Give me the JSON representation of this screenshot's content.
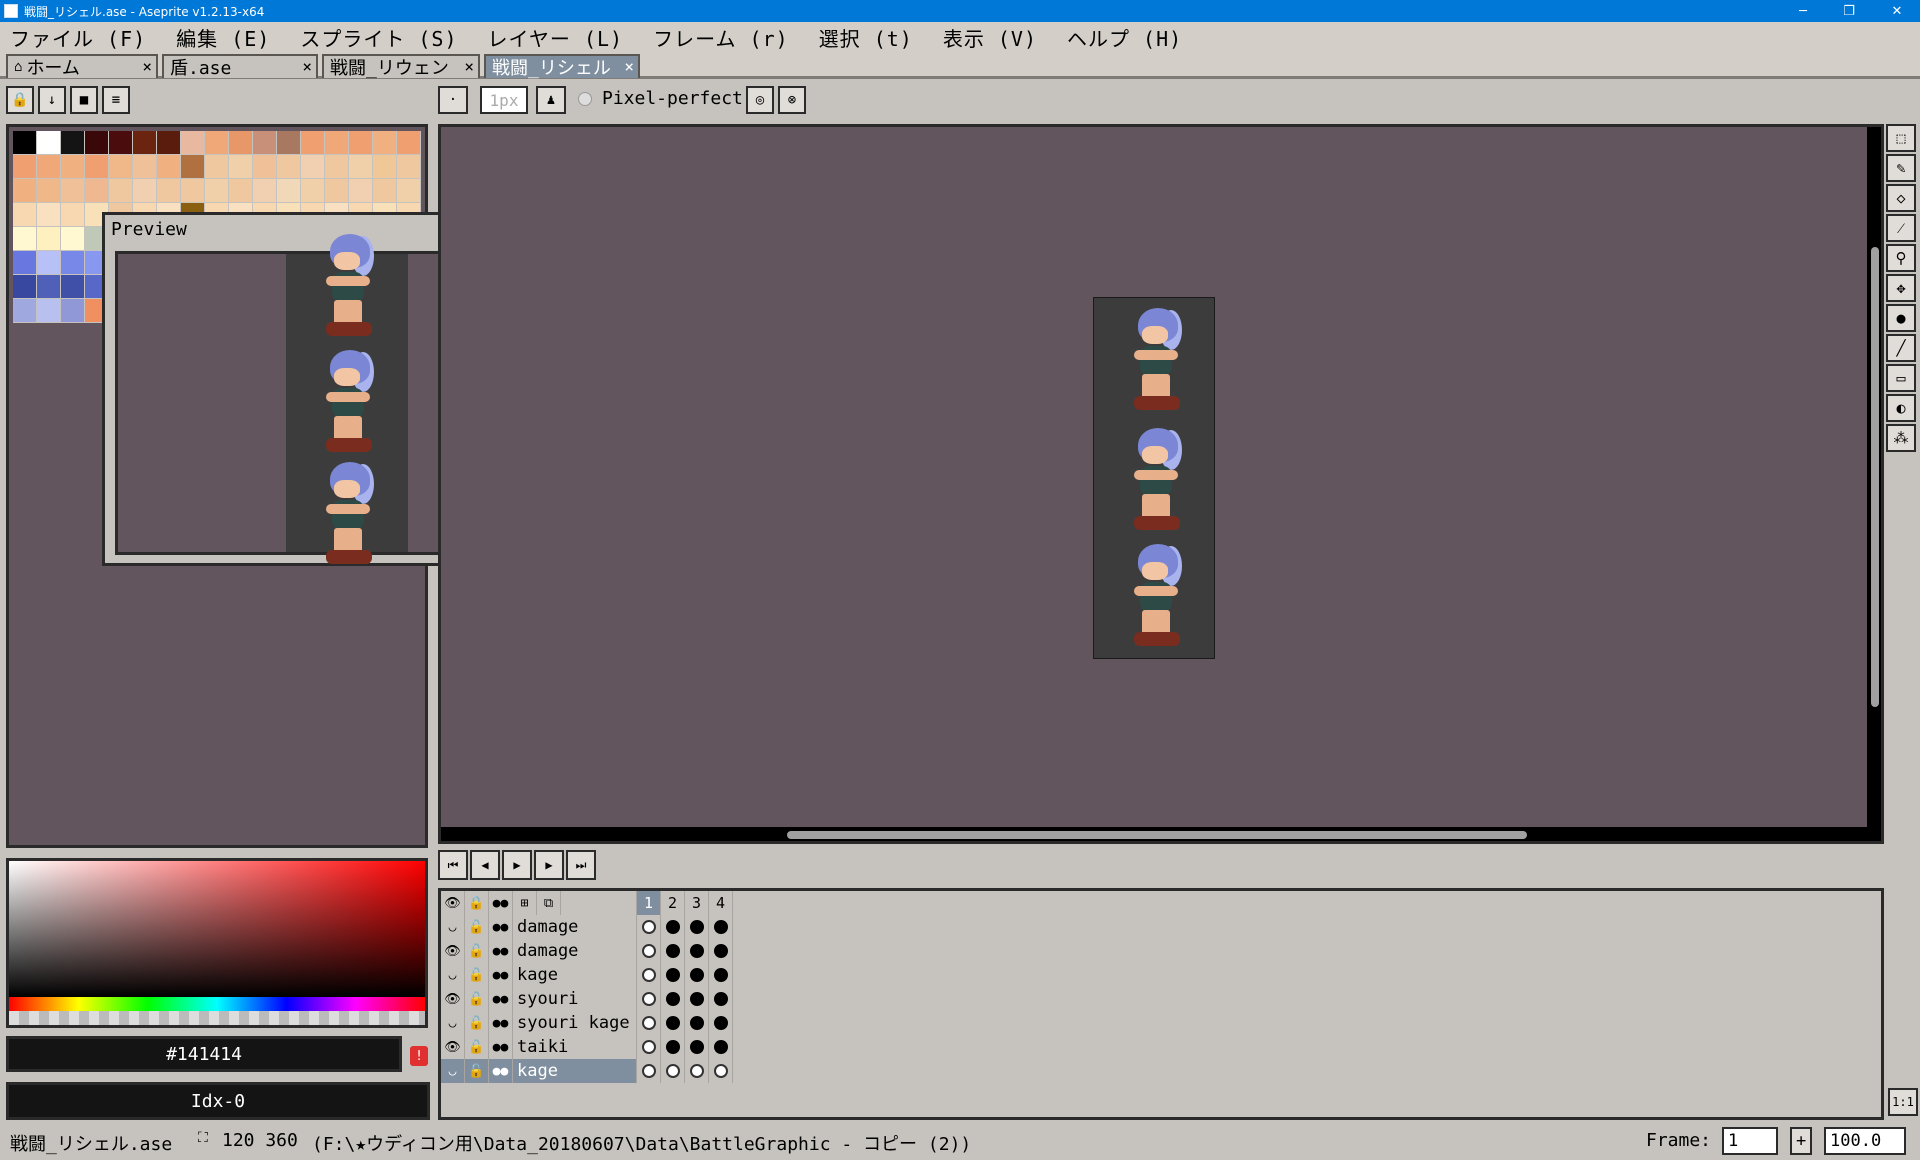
{
  "window": {
    "title": "戦闘_リシェル.ase - Aseprite v1.2.13-x64",
    "minimize": "─",
    "restore": "❐",
    "close": "✕"
  },
  "menu": [
    "ファイル (F)",
    "編集 (E)",
    "スプライト (S)",
    "レイヤー (L)",
    "フレーム (r)",
    "選択 (t)",
    "表示 (V)",
    "ヘルプ (H)"
  ],
  "tabs": [
    {
      "label": "ホーム",
      "close": "×"
    },
    {
      "label": "盾.ase",
      "close": "×"
    },
    {
      "label": "戦闘_リウェン",
      "close": "×"
    },
    {
      "label": "戦闘_リシェル",
      "close": "×"
    }
  ],
  "context_bar": {
    "brush_size": "1px",
    "pixel_perfect_label": "Pixel-perfect"
  },
  "palette": [
    "#000000",
    "#ffffff",
    "#141414",
    "#3a0808",
    "#4a0c0c",
    "#6a2410",
    "#5a1c0c",
    "#e8b8a0",
    "#f0a878",
    "#e89868",
    "#c89078",
    "#a87860",
    "#f0a070",
    "#f0a878",
    "#f0a070",
    "#f0b080",
    "#f0a070",
    "#f0a070",
    "#f0a878",
    "#f0b080",
    "#f0a070",
    "#f0b888",
    "#f0c098",
    "#f0b080",
    "#b07040",
    "#f0c8a0",
    "#f0d0a8",
    "#f0c098",
    "#f0c8a0",
    "#f0d0b0",
    "#f0c8a0",
    "#f0d0a8",
    "#f0c898",
    "#f0c8a0",
    "#f0b080",
    "#f0b888",
    "#f0c098",
    "#f0b890",
    "#f0c8a0",
    "#f0d0b0",
    "#f0c8a0",
    "#f0c8a0",
    "#f0d0a8",
    "#f0c8a0",
    "#f0d0b0",
    "#f0d8b8",
    "#f0d0a8",
    "#f0c8a0",
    "#f0d0b0",
    "#f0c8a0",
    "#f0d0a8",
    "#f8d8b0",
    "#f8e0c0",
    "#f8d8b0",
    "#f8e0b8",
    "#f0c8a0",
    "#f8d8b0",
    "#f8e0c0",
    "#8a6010",
    "#f8d8b0",
    "#f8e0c0",
    "#f8d8b0",
    "#f8e0b8",
    "#f8d8b0",
    "#f8e0c0",
    "#f8d8b0",
    "#f8e0b8",
    "#f8d8b0",
    "#fff8d0",
    "#fff0c0",
    "#fff8d0",
    "#c0c8b8",
    "#fff8d0",
    "#fff0c0",
    "#fff8d0",
    "#fff0c0",
    "#fff8d0",
    "#fff0c0",
    "#fff8d0",
    "#fff0c0",
    "#fff8d0",
    "#fff0c0",
    "#fff8d0",
    "#fff0c0",
    "#fff8d0",
    "#6878e0",
    "#b8c0f8",
    "#7888e8",
    "#8898f0",
    "#6878e0",
    "#7888e8",
    "#6878e0",
    "#7888e8",
    "#6878e0",
    "#7888e8",
    "#6878e0",
    "#7888e8",
    "#6878e0",
    "#7888e8",
    "#6878e0",
    "#7888e8",
    "#6878e0",
    "#3848a0",
    "#5060b8",
    "#4050a8",
    "#5868c8",
    "#3848a0",
    "#5060b8",
    "#3848a0",
    "#5060b8",
    "#3848a0",
    "#5060b8",
    "#3848a0",
    "#5060b8",
    "#3848a0",
    "#5060b8",
    "#3848a0",
    "#5060b8",
    "#3848a0",
    "#a0a8e0",
    "#b8c0f0",
    "#9098d8",
    "#f09060",
    "#a0a8e0",
    "#b8c0f0",
    "#9098d8",
    "#b8c0f0",
    "#a0a8e0",
    "#b8c0f0",
    "#9098d8",
    "#b8c0f0",
    "#a0a8e0",
    "#b8c0f0",
    "#9098d8",
    "#b8c0f0",
    "#a0a8e0"
  ],
  "preview": {
    "title": "Preview"
  },
  "color": {
    "hex": "#141414",
    "index": "Idx-0",
    "warning": "!"
  },
  "timeline": {
    "frames": [
      "1",
      "2",
      "3",
      "4"
    ],
    "layers": [
      {
        "name": "damage",
        "visible": false,
        "cels": [
          false,
          true,
          true,
          true
        ]
      },
      {
        "name": "damage",
        "visible": true,
        "cels": [
          false,
          true,
          true,
          true
        ]
      },
      {
        "name": "kage",
        "visible": false,
        "cels": [
          false,
          true,
          true,
          true
        ]
      },
      {
        "name": "syouri",
        "visible": true,
        "cels": [
          false,
          true,
          true,
          true
        ]
      },
      {
        "name": "syouri kage",
        "visible": false,
        "cels": [
          false,
          true,
          true,
          true
        ]
      },
      {
        "name": "taiki",
        "visible": true,
        "cels": [
          false,
          true,
          true,
          true
        ]
      },
      {
        "name": "kage",
        "visible": false,
        "cels": [
          false,
          false,
          false,
          false
        ],
        "selected": true
      }
    ],
    "zoom_button": "1:1"
  },
  "status": {
    "filename": "戦闘_リシェル.ase",
    "size": "120 360",
    "path": "(F:\\★ウディコン用\\Data_20180607\\Data\\BattleGraphic - コピー (2))",
    "frame_label": "Frame:",
    "frame_value": "1",
    "plus": "+",
    "zoom_value": "100.0"
  }
}
